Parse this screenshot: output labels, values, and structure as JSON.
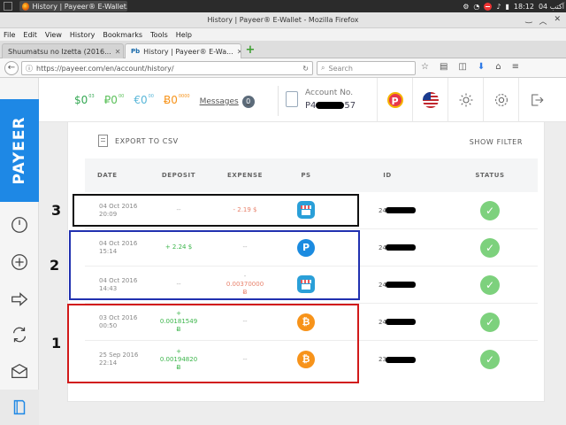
{
  "os": {
    "task_title": "History | Payeer® E-Wallet...",
    "clock": "18:12",
    "date_label": "04 آكتب"
  },
  "window": {
    "title": "History | Payeer® E-Wallet - Mozilla Firefox"
  },
  "menu": [
    "File",
    "Edit",
    "View",
    "History",
    "Bookmarks",
    "Tools",
    "Help"
  ],
  "tabs": [
    {
      "label": "Shuumatsu no Izetta (2016..."
    },
    {
      "label": "History | Payeer® E-Wa..."
    }
  ],
  "nav": {
    "url": "https://payeer.com/en/account/history/",
    "search_placeholder": "Search"
  },
  "sidebar": {
    "logo": "PAYEER",
    "items": [
      "dashboard-icon",
      "add-funds-icon",
      "transfer-icon",
      "exchange-icon",
      "messages-icon",
      "history-icon"
    ]
  },
  "header": {
    "balances": [
      {
        "symbol": "$",
        "value": "0",
        "decimals": "03",
        "color": "#34a853"
      },
      {
        "symbol": "₽",
        "value": "0",
        "decimals": "00",
        "color": "#5bc05a"
      },
      {
        "symbol": "€",
        "value": "0",
        "decimals": "00",
        "color": "#58b6d8"
      },
      {
        "symbol": "Ƀ",
        "value": "0",
        "decimals": "0000",
        "color": "#f7931a"
      }
    ],
    "messages_label": "Messages",
    "messages_count": "0",
    "account_label": "Account No.",
    "account_prefix": "P4",
    "account_suffix": "57"
  },
  "history": {
    "export_label": "EXPORT TO CSV",
    "show_filter_label": "SHOW FILTER",
    "columns": {
      "date": "DATE",
      "deposit": "DEPOSIT",
      "expense": "EXPENSE",
      "ps": "PS",
      "id": "ID",
      "status": "STATUS"
    },
    "rows": [
      {
        "date": "04 Oct 2016",
        "time": "20:09",
        "deposit": "--",
        "expense": "- 2.19 $",
        "ps": "exchange",
        "id_prefix": "24"
      },
      {
        "date": "04 Oct 2016",
        "time": "15:14",
        "deposit": "+ 2.24 $",
        "expense": "--",
        "ps": "payeer",
        "id_prefix": "24"
      },
      {
        "date": "04 Oct 2016",
        "time": "14:43",
        "deposit": "--",
        "expense_line1": "-",
        "expense_line2": "0.00370000",
        "expense_line3": "Ƀ",
        "ps": "exchange",
        "id_prefix": "24"
      },
      {
        "date": "03 Oct 2016",
        "time": "00:50",
        "deposit_line1": "+",
        "deposit_line2": "0.00181549",
        "deposit_line3": "Ƀ",
        "expense": "--",
        "ps": "bitcoin",
        "id_prefix": "24"
      },
      {
        "date": "25 Sep 2016",
        "time": "22:14",
        "deposit_line1": "+",
        "deposit_line2": "0.00194820",
        "deposit_line3": "Ƀ",
        "expense": "--",
        "ps": "bitcoin",
        "id_prefix": "23"
      }
    ]
  },
  "annotations": [
    {
      "label": "3",
      "color": "#111111"
    },
    {
      "label": "2",
      "color": "#2131b0"
    },
    {
      "label": "1",
      "color": "#d11a1a"
    }
  ]
}
